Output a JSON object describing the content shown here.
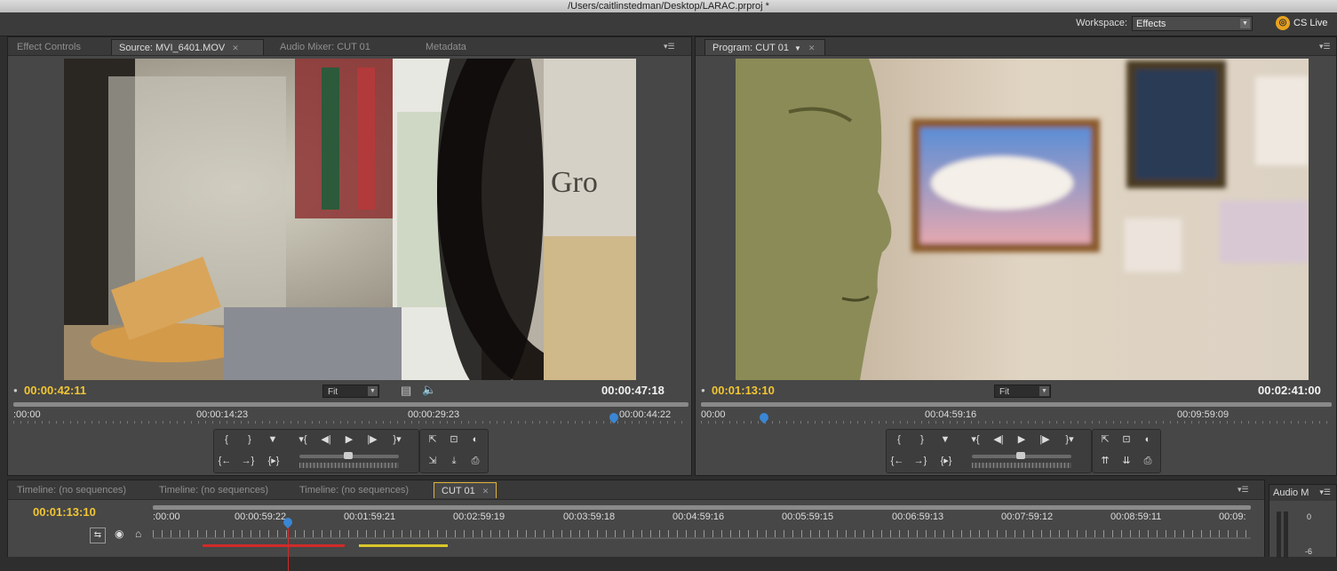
{
  "window": {
    "title": "/Users/caitlinstedman/Desktop/LARAC.prproj *"
  },
  "workspace": {
    "label": "Workspace:",
    "value": "Effects",
    "cs_live": "CS Live",
    "cs_live_icon": "cs-live-icon"
  },
  "source_panel": {
    "tabs": [
      "Effect Controls",
      "Source: MVI_6401.MOV",
      "Audio Mixer: CUT 01",
      "Metadata"
    ],
    "active_tab": 1,
    "timecode_current": "00:00:42:11",
    "timecode_duration": "00:00:47:18",
    "fit": "Fit",
    "ruler_labels": [
      ":00:00",
      "00:00:14:23",
      "00:00:29:23",
      "00:00:44:22"
    ],
    "playhead_fraction": 0.89,
    "buttons": {
      "row1": [
        "{",
        "}",
        "▼",
        "▾{",
        "◀|",
        "▶",
        "|▶",
        "}▾"
      ],
      "row2": [
        "{←",
        "→}",
        "{▸}"
      ],
      "side1": [
        "⇱",
        "⊡",
        "◐"
      ],
      "side2": [
        "⇲",
        "⤓",
        "⎙"
      ]
    }
  },
  "program_panel": {
    "tabs": [
      "Program: CUT 01"
    ],
    "timecode_current": "00:01:13:10",
    "timecode_duration": "00:02:41:00",
    "fit": "Fit",
    "ruler_labels": [
      "00:00",
      "00:04:59:16",
      "00:09:59:09"
    ],
    "playhead_fraction": 0.1,
    "buttons": {
      "row1": [
        "{",
        "}",
        "▼",
        "▾{",
        "◀|",
        "▶",
        "|▶",
        "}▾"
      ],
      "row2": [
        "{←",
        "→}",
        "{▸}"
      ],
      "side1": [
        "⇱",
        "⊡",
        "◐"
      ],
      "side2": [
        "⇈",
        "⇊",
        "⎙"
      ]
    }
  },
  "timeline": {
    "tabs": [
      "Timeline: (no sequences)",
      "Timeline: (no sequences)",
      "Timeline: (no sequences)",
      "CUT 01"
    ],
    "active_tab": 3,
    "timecode": "00:01:13:10",
    "ruler_labels": [
      ":00:00",
      "00:00:59:22",
      "00:01:59:21",
      "00:02:59:19",
      "00:03:59:18",
      "00:04:59:16",
      "00:05:59:15",
      "00:06:59:13",
      "00:07:59:12",
      "00:08:59:11",
      "00:09:"
    ]
  },
  "audio_meters": {
    "title": "Audio M",
    "levels": [
      "0",
      "-6"
    ]
  },
  "colors": {
    "timecode_yellow": "#f2c633",
    "playhead_blue": "#3a86d4",
    "active_border": "#e0b43a"
  }
}
